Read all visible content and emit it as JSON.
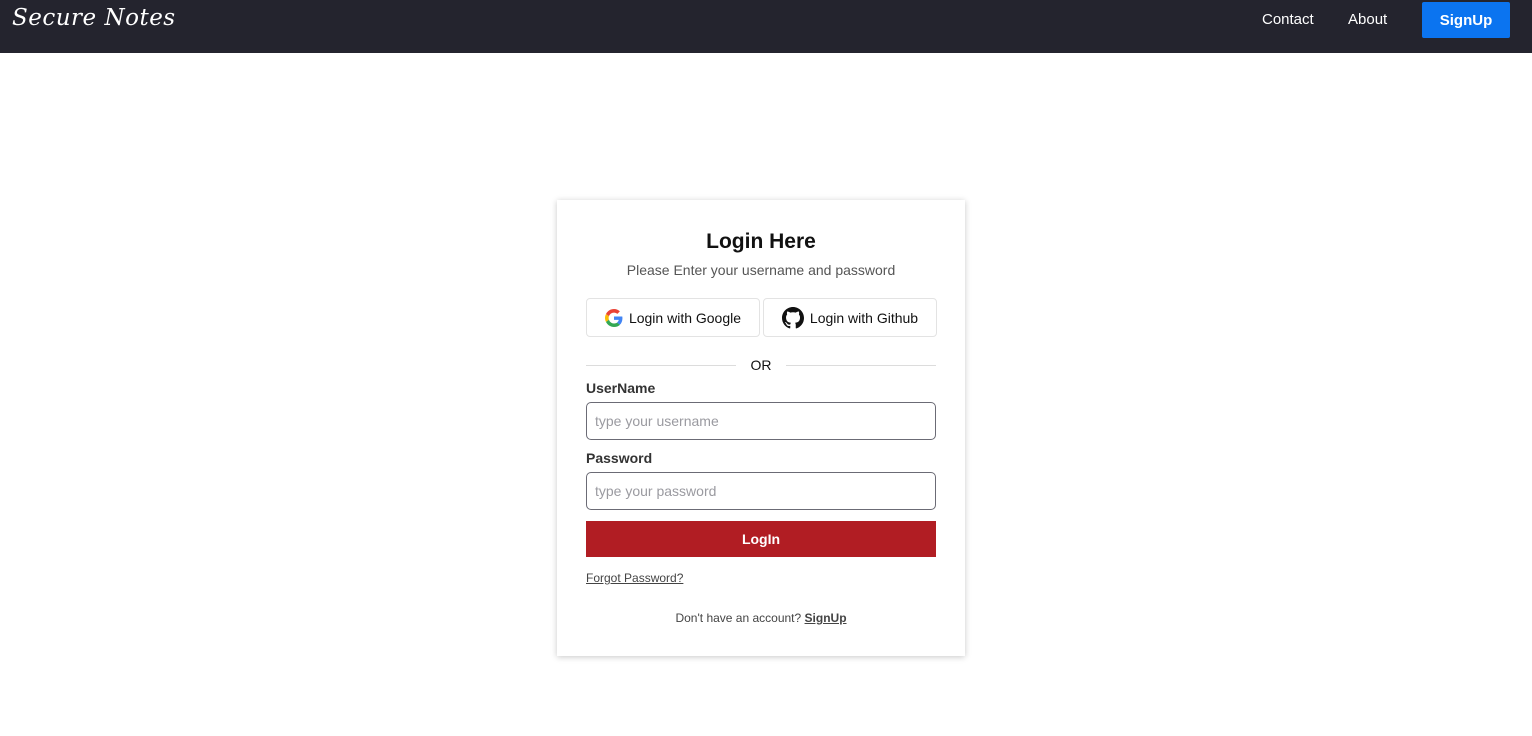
{
  "navbar": {
    "brand": "Secure Notes",
    "links": {
      "contact": "Contact",
      "about": "About"
    },
    "signup_label": "SignUp",
    "background": "#24242e",
    "signup_color": "#0b74f0"
  },
  "login_card": {
    "title": "Login Here",
    "subtitle": "Please Enter your username and password",
    "oauth": {
      "google_label": "Login with Google",
      "github_label": "Login with Github",
      "google_icon": "google-icon",
      "github_icon": "github-icon"
    },
    "divider_text": "OR",
    "username": {
      "label": "UserName",
      "placeholder": "type your username",
      "value": ""
    },
    "password": {
      "label": "Password",
      "placeholder": "type your password",
      "value": ""
    },
    "login_label": "LogIn",
    "login_color": "#b11d23",
    "forgot_label": "Forgot Password?",
    "no_account_text": "Don't have an account?",
    "signup_label": "SignUp"
  }
}
